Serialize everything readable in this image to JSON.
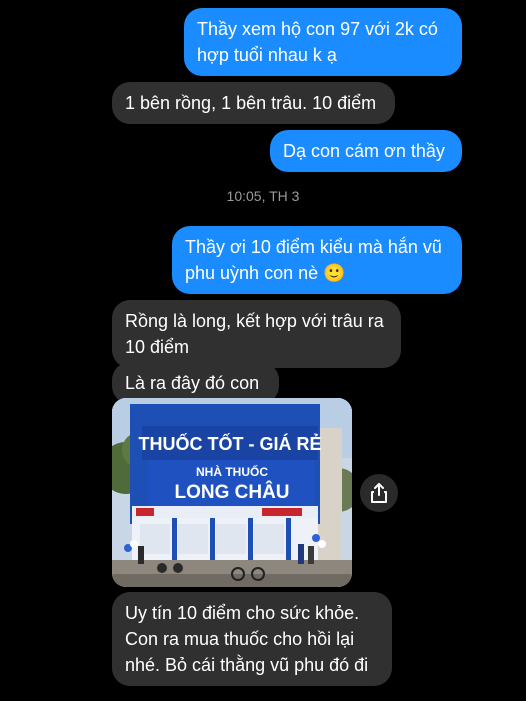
{
  "messages": [
    {
      "side": "out",
      "text": "Thầy xem hộ con 97 với 2k có hợp tuổi nhau k ạ"
    },
    {
      "side": "in",
      "text": "1 bên rồng, 1 bên trâu. 10 điểm"
    },
    {
      "side": "out",
      "text": "Dạ con cám ơn thầy"
    },
    {
      "side": "out",
      "text": "Thầy ơi 10 điểm kiểu mà hắn vũ phu uỳnh con nè",
      "emoji": "🙂"
    },
    {
      "side": "in",
      "text": "Rồng là long, kết hợp với trâu ra 10 điểm"
    },
    {
      "side": "in",
      "text": "Là ra đây đó con"
    },
    {
      "side": "in",
      "text": "Uy tín 10 điểm cho sức khỏe. Con ra mua thuốc cho hồi lại nhé. Bỏ cái thằng vũ phu đó đi"
    }
  ],
  "timestamp": "10:05, TH 3",
  "photo": {
    "sign_top": "THUỐC TỐT - GIÁ RẺ",
    "sign_mid": "NHÀ THUỐC",
    "sign_brand": "LONG CHÂU"
  },
  "colors": {
    "outgoing": "#1a8cff",
    "incoming": "#303030",
    "background": "#000000"
  },
  "icons": {
    "share": "share-icon"
  }
}
